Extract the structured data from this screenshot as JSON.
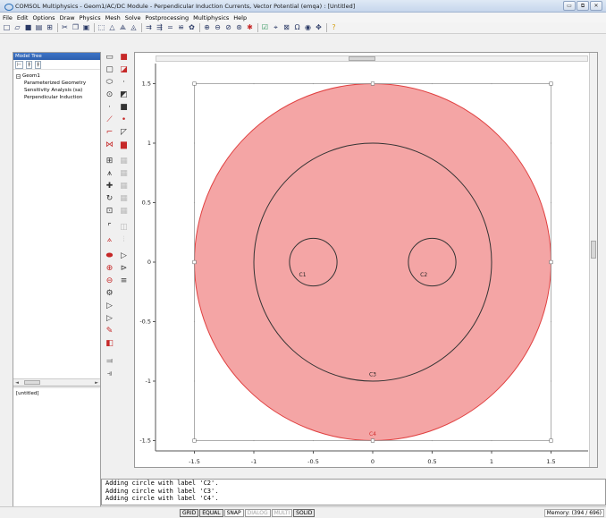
{
  "window": {
    "title": "COMSOL Multiphysics - Geom1/AC/DC Module - Perpendicular Induction Currents, Vector Potential (emqa) : [Untitled]",
    "minimize_glyph": "▭",
    "restore_glyph": "⧉",
    "close_glyph": "✕"
  },
  "menu": [
    "File",
    "Edit",
    "Options",
    "Draw",
    "Physics",
    "Mesh",
    "Solve",
    "Postprocessing",
    "Multiphysics",
    "Help"
  ],
  "left_panel": {
    "header": "Model Tree",
    "tools": [
      "⊢",
      "‡",
      "‡"
    ],
    "tree_root": "Geom1",
    "tree_toggle": "−",
    "tree_children": [
      "Parameterized Geometry",
      "Sensitivity Analysis (sa)",
      "Perpendicular Induction"
    ],
    "scroll_left": "◄",
    "scroll_right": "►",
    "untitled": "[untitled]"
  },
  "canvas_scroll": {
    "left": "◄",
    "right": "►",
    "up": "▲",
    "down": "▼"
  },
  "plot": {
    "x_ticks": [
      -1.5,
      -1,
      -0.5,
      0,
      0.5,
      1,
      1.5
    ],
    "y_ticks": [
      1.5,
      1,
      0.5,
      0,
      -0.5,
      -1,
      -1.5
    ],
    "x_tick_labels": [
      "-1.5",
      "-1",
      "-0.5",
      "0",
      "0.5",
      "1",
      "1.5"
    ],
    "y_tick_labels": [
      "1.5",
      "1",
      "0.5",
      "0",
      "-0.5",
      "-1",
      "-1.5"
    ],
    "grid_dots": [
      -1.5,
      -1,
      -0.5,
      0,
      0.5,
      1,
      1.5
    ],
    "circles": [
      {
        "label": "C4",
        "cx": 0,
        "cy": 0,
        "r": 1.5,
        "fill": "#f4a5a5",
        "stroke": "#e04040",
        "label_x": 0,
        "label_y": -1.46
      },
      {
        "label": "C3",
        "cx": 0,
        "cy": 0,
        "r": 1.0,
        "fill": "none",
        "stroke": "#333333",
        "label_x": 0,
        "label_y": -0.96
      },
      {
        "label": "C1",
        "cx": -0.5,
        "cy": 0,
        "r": 0.2,
        "fill": "none",
        "stroke": "#333333",
        "label_x": -0.59,
        "label_y": -0.12
      },
      {
        "label": "C2",
        "cx": 0.5,
        "cy": 0,
        "r": 0.2,
        "fill": "none",
        "stroke": "#333333",
        "label_x": 0.43,
        "label_y": -0.12
      }
    ],
    "bbox_color": "#999999"
  },
  "log": [
    "Adding circle with label 'C2'.",
    "Adding circle with label 'C3'.",
    "Adding circle with label 'C4'."
  ],
  "status": {
    "toggles": [
      {
        "label": "GRID",
        "state": "active"
      },
      {
        "label": "EQUAL",
        "state": "active"
      },
      {
        "label": "SNAP",
        "state": "normal"
      },
      {
        "label": "DIALOG",
        "state": "disabled"
      },
      {
        "label": "MULTI",
        "state": "disabled"
      },
      {
        "label": "SOLID",
        "state": "active"
      }
    ],
    "memory": "Memory: (394 / 696)"
  },
  "toolbar_icons": [
    "new-icon",
    "open-icon",
    "save-icon",
    "print-icon",
    "model-tree-icon",
    "cut-icon",
    "copy-icon",
    "paste-icon",
    "select-icon",
    "draw-mode-icon",
    "point-mode-icon",
    "boundary-mode-icon",
    "subdomain-mode-icon",
    "equation-icon",
    "mesh-icon",
    "refine-icon",
    "solve-icon",
    "zoom-in-icon",
    "zoom-out-icon",
    "zoom-window-icon",
    "zoom-extents-icon",
    "plot-icon",
    "parameters-icon",
    "help-icon"
  ]
}
